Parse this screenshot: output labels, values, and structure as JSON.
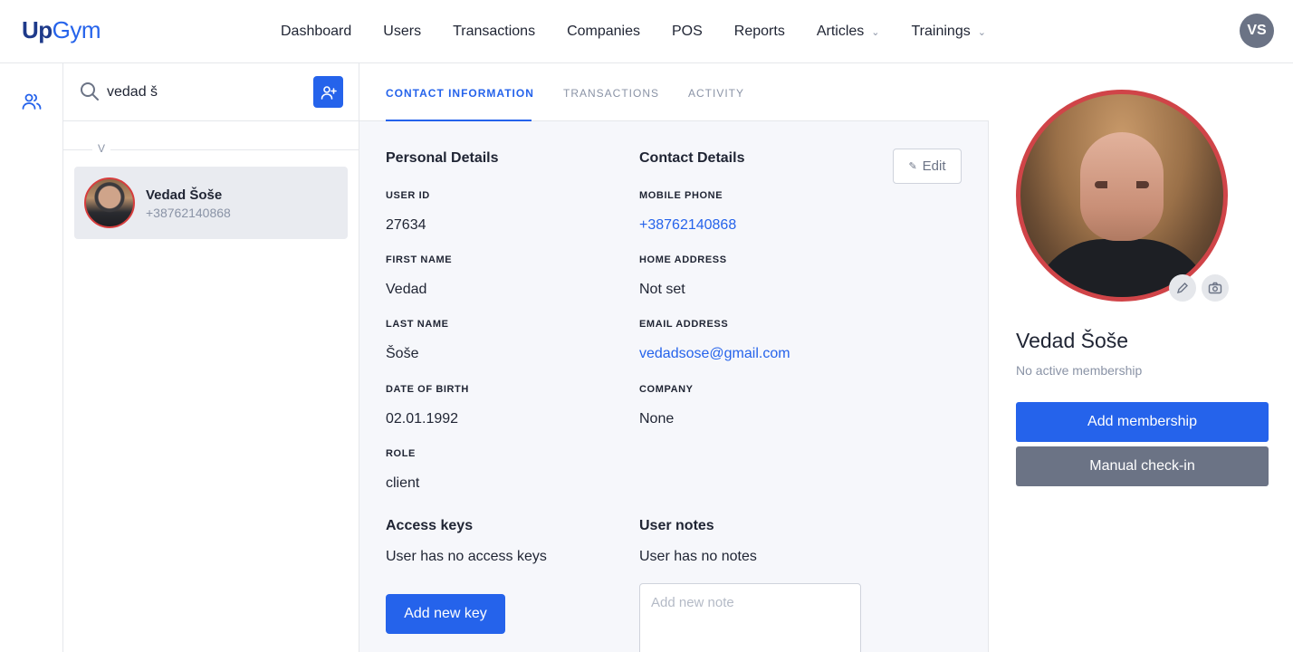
{
  "app": {
    "logo_up": "Up",
    "logo_gym": "Gym",
    "user_initials": "VS"
  },
  "nav": {
    "items": [
      {
        "label": "Dashboard"
      },
      {
        "label": "Users"
      },
      {
        "label": "Transactions"
      },
      {
        "label": "Companies"
      },
      {
        "label": "POS"
      },
      {
        "label": "Reports"
      },
      {
        "label": "Articles",
        "has_dropdown": true
      },
      {
        "label": "Trainings",
        "has_dropdown": true
      }
    ]
  },
  "search": {
    "value": "vedad š",
    "group_letter": "V",
    "results": [
      {
        "name": "Vedad Šoše",
        "phone": "+38762140868"
      }
    ]
  },
  "tabs": {
    "contact": "CONTACT INFORMATION",
    "transactions": "TRANSACTIONS",
    "activity": "ACTIVITY",
    "active": "contact"
  },
  "personal": {
    "title": "Personal Details",
    "user_id_label": "USER ID",
    "user_id": "27634",
    "first_name_label": "FIRST NAME",
    "first_name": "Vedad",
    "last_name_label": "LAST NAME",
    "last_name": "Šoše",
    "dob_label": "DATE OF BIRTH",
    "dob": "02.01.1992",
    "role_label": "ROLE",
    "role": "client"
  },
  "contact": {
    "title": "Contact Details",
    "edit_label": "Edit",
    "mobile_label": "MOBILE PHONE",
    "mobile": "+38762140868",
    "home_label": "HOME ADDRESS",
    "home": "Not set",
    "email_label": "EMAIL ADDRESS",
    "email": "vedadsose@gmail.com",
    "company_label": "COMPANY",
    "company": "None"
  },
  "access_keys": {
    "title": "Access keys",
    "empty_text": "User has no access keys",
    "add_button": "Add new key"
  },
  "notes": {
    "title": "User notes",
    "empty_text": "User has no notes",
    "placeholder": "Add new note"
  },
  "profile": {
    "name": "Vedad Šoše",
    "membership_status": "No active membership",
    "add_membership": "Add membership",
    "manual_checkin": "Manual check-in"
  },
  "colors": {
    "primary": "#2563eb",
    "secondary_button": "#6b7385",
    "avatar_ring": "#d04448"
  }
}
